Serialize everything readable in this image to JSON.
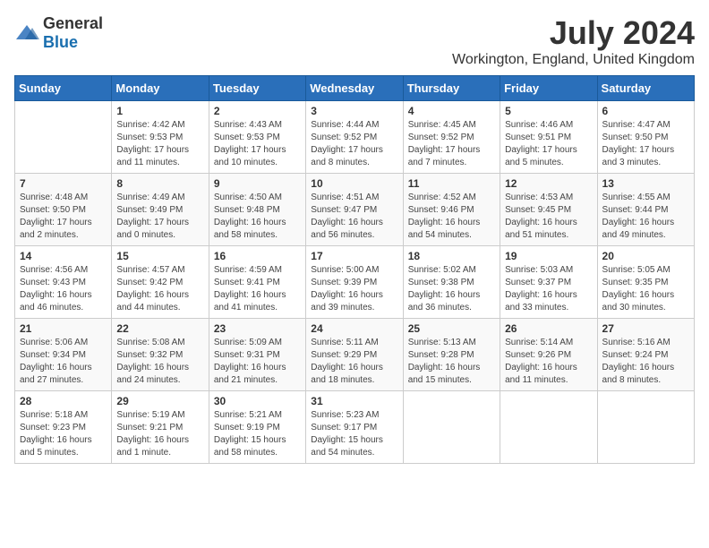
{
  "logo": {
    "general": "General",
    "blue": "Blue"
  },
  "title": "July 2024",
  "location": "Workington, England, United Kingdom",
  "days_of_week": [
    "Sunday",
    "Monday",
    "Tuesday",
    "Wednesday",
    "Thursday",
    "Friday",
    "Saturday"
  ],
  "weeks": [
    [
      {
        "day": "",
        "info": ""
      },
      {
        "day": "1",
        "info": "Sunrise: 4:42 AM\nSunset: 9:53 PM\nDaylight: 17 hours\nand 11 minutes."
      },
      {
        "day": "2",
        "info": "Sunrise: 4:43 AM\nSunset: 9:53 PM\nDaylight: 17 hours\nand 10 minutes."
      },
      {
        "day": "3",
        "info": "Sunrise: 4:44 AM\nSunset: 9:52 PM\nDaylight: 17 hours\nand 8 minutes."
      },
      {
        "day": "4",
        "info": "Sunrise: 4:45 AM\nSunset: 9:52 PM\nDaylight: 17 hours\nand 7 minutes."
      },
      {
        "day": "5",
        "info": "Sunrise: 4:46 AM\nSunset: 9:51 PM\nDaylight: 17 hours\nand 5 minutes."
      },
      {
        "day": "6",
        "info": "Sunrise: 4:47 AM\nSunset: 9:50 PM\nDaylight: 17 hours\nand 3 minutes."
      }
    ],
    [
      {
        "day": "7",
        "info": "Sunrise: 4:48 AM\nSunset: 9:50 PM\nDaylight: 17 hours\nand 2 minutes."
      },
      {
        "day": "8",
        "info": "Sunrise: 4:49 AM\nSunset: 9:49 PM\nDaylight: 17 hours\nand 0 minutes."
      },
      {
        "day": "9",
        "info": "Sunrise: 4:50 AM\nSunset: 9:48 PM\nDaylight: 16 hours\nand 58 minutes."
      },
      {
        "day": "10",
        "info": "Sunrise: 4:51 AM\nSunset: 9:47 PM\nDaylight: 16 hours\nand 56 minutes."
      },
      {
        "day": "11",
        "info": "Sunrise: 4:52 AM\nSunset: 9:46 PM\nDaylight: 16 hours\nand 54 minutes."
      },
      {
        "day": "12",
        "info": "Sunrise: 4:53 AM\nSunset: 9:45 PM\nDaylight: 16 hours\nand 51 minutes."
      },
      {
        "day": "13",
        "info": "Sunrise: 4:55 AM\nSunset: 9:44 PM\nDaylight: 16 hours\nand 49 minutes."
      }
    ],
    [
      {
        "day": "14",
        "info": "Sunrise: 4:56 AM\nSunset: 9:43 PM\nDaylight: 16 hours\nand 46 minutes."
      },
      {
        "day": "15",
        "info": "Sunrise: 4:57 AM\nSunset: 9:42 PM\nDaylight: 16 hours\nand 44 minutes."
      },
      {
        "day": "16",
        "info": "Sunrise: 4:59 AM\nSunset: 9:41 PM\nDaylight: 16 hours\nand 41 minutes."
      },
      {
        "day": "17",
        "info": "Sunrise: 5:00 AM\nSunset: 9:39 PM\nDaylight: 16 hours\nand 39 minutes."
      },
      {
        "day": "18",
        "info": "Sunrise: 5:02 AM\nSunset: 9:38 PM\nDaylight: 16 hours\nand 36 minutes."
      },
      {
        "day": "19",
        "info": "Sunrise: 5:03 AM\nSunset: 9:37 PM\nDaylight: 16 hours\nand 33 minutes."
      },
      {
        "day": "20",
        "info": "Sunrise: 5:05 AM\nSunset: 9:35 PM\nDaylight: 16 hours\nand 30 minutes."
      }
    ],
    [
      {
        "day": "21",
        "info": "Sunrise: 5:06 AM\nSunset: 9:34 PM\nDaylight: 16 hours\nand 27 minutes."
      },
      {
        "day": "22",
        "info": "Sunrise: 5:08 AM\nSunset: 9:32 PM\nDaylight: 16 hours\nand 24 minutes."
      },
      {
        "day": "23",
        "info": "Sunrise: 5:09 AM\nSunset: 9:31 PM\nDaylight: 16 hours\nand 21 minutes."
      },
      {
        "day": "24",
        "info": "Sunrise: 5:11 AM\nSunset: 9:29 PM\nDaylight: 16 hours\nand 18 minutes."
      },
      {
        "day": "25",
        "info": "Sunrise: 5:13 AM\nSunset: 9:28 PM\nDaylight: 16 hours\nand 15 minutes."
      },
      {
        "day": "26",
        "info": "Sunrise: 5:14 AM\nSunset: 9:26 PM\nDaylight: 16 hours\nand 11 minutes."
      },
      {
        "day": "27",
        "info": "Sunrise: 5:16 AM\nSunset: 9:24 PM\nDaylight: 16 hours\nand 8 minutes."
      }
    ],
    [
      {
        "day": "28",
        "info": "Sunrise: 5:18 AM\nSunset: 9:23 PM\nDaylight: 16 hours\nand 5 minutes."
      },
      {
        "day": "29",
        "info": "Sunrise: 5:19 AM\nSunset: 9:21 PM\nDaylight: 16 hours\nand 1 minute."
      },
      {
        "day": "30",
        "info": "Sunrise: 5:21 AM\nSunset: 9:19 PM\nDaylight: 15 hours\nand 58 minutes."
      },
      {
        "day": "31",
        "info": "Sunrise: 5:23 AM\nSunset: 9:17 PM\nDaylight: 15 hours\nand 54 minutes."
      },
      {
        "day": "",
        "info": ""
      },
      {
        "day": "",
        "info": ""
      },
      {
        "day": "",
        "info": ""
      }
    ]
  ]
}
